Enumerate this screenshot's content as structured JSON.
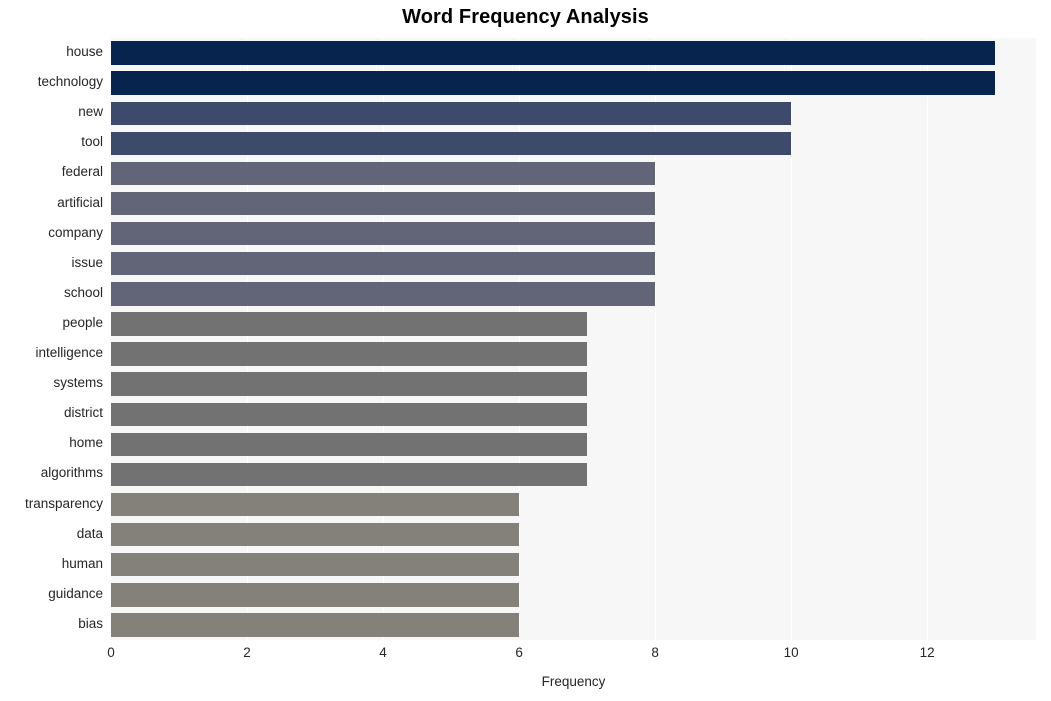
{
  "chart_data": {
    "type": "bar",
    "orientation": "horizontal",
    "title": "Word Frequency Analysis",
    "xlabel": "Frequency",
    "ylabel": "",
    "categories": [
      "house",
      "technology",
      "new",
      "tool",
      "federal",
      "artificial",
      "company",
      "issue",
      "school",
      "people",
      "intelligence",
      "systems",
      "district",
      "home",
      "algorithms",
      "transparency",
      "data",
      "human",
      "guidance",
      "bias"
    ],
    "values": [
      13,
      13,
      10,
      10,
      8,
      8,
      8,
      8,
      8,
      7,
      7,
      7,
      7,
      7,
      7,
      6,
      6,
      6,
      6,
      6
    ],
    "bar_colors": [
      "#06244e",
      "#06244e",
      "#3e4a6b",
      "#3e4a6b",
      "#616577",
      "#616577",
      "#616577",
      "#616577",
      "#616577",
      "#727272",
      "#727272",
      "#727272",
      "#727272",
      "#727272",
      "#727272",
      "#83817a",
      "#83817a",
      "#83817a",
      "#83817a",
      "#83817a"
    ],
    "xlim": [
      0,
      13.6
    ],
    "xticks": [
      0,
      2,
      4,
      6,
      8,
      10,
      12
    ],
    "xtick_labels": [
      "0",
      "2",
      "4",
      "6",
      "8",
      "10",
      "12"
    ],
    "grid": "vertical-white",
    "legend": "none",
    "plot_background": "#f7f7f7",
    "figure_background": "#ffffff"
  }
}
